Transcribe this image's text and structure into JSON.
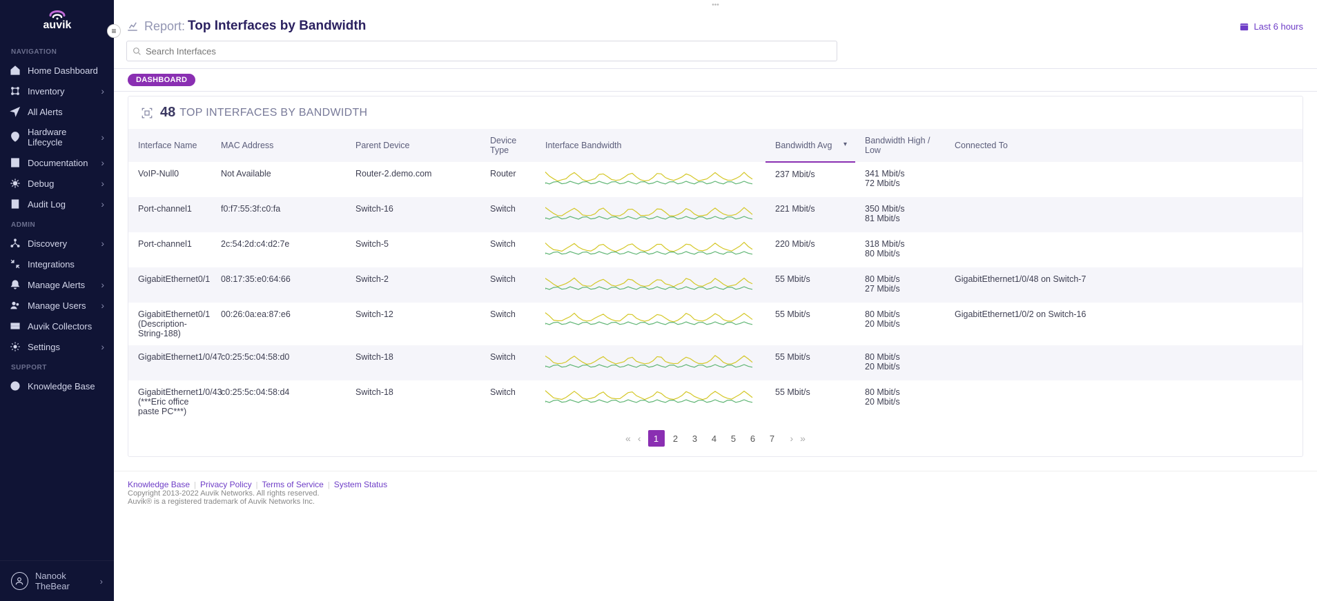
{
  "sidebar": {
    "navLabel": "NAVIGATION",
    "adminLabel": "ADMIN",
    "supportLabel": "SUPPORT",
    "items": [
      {
        "label": "Home Dashboard",
        "expandable": false
      },
      {
        "label": "Inventory",
        "expandable": true
      },
      {
        "label": "All Alerts",
        "expandable": false
      },
      {
        "label": "Hardware Lifecycle",
        "expandable": true
      },
      {
        "label": "Documentation",
        "expandable": true
      },
      {
        "label": "Debug",
        "expandable": true
      },
      {
        "label": "Audit Log",
        "expandable": true
      }
    ],
    "adminItems": [
      {
        "label": "Discovery",
        "expandable": true
      },
      {
        "label": "Integrations",
        "expandable": false
      },
      {
        "label": "Manage Alerts",
        "expandable": true
      },
      {
        "label": "Manage Users",
        "expandable": true
      },
      {
        "label": "Auvik Collectors",
        "expandable": false
      },
      {
        "label": "Settings",
        "expandable": true
      }
    ],
    "supportItems": [
      {
        "label": "Knowledge Base",
        "expandable": false
      }
    ],
    "user": "Nanook TheBear"
  },
  "header": {
    "reportLabel": "Report:",
    "title": "Top Interfaces by Bandwidth",
    "timeRange": "Last 6 hours"
  },
  "search": {
    "placeholder": "Search Interfaces"
  },
  "chip": "DASHBOARD",
  "panel": {
    "count": "48",
    "title": "TOP INTERFACES BY BANDWIDTH"
  },
  "columns": [
    "Interface Name",
    "MAC Address",
    "Parent Device",
    "Device Type",
    "Interface Bandwidth",
    "Bandwidth Avg",
    "Bandwidth High / Low",
    "Connected To"
  ],
  "sortColumnIndex": 5,
  "rows": [
    {
      "name": "VoIP-Null0",
      "mac": "Not Available",
      "parent": "Router-2.demo.com",
      "type": "Router",
      "avg": "237 Mbit/s",
      "high": "341 Mbit/s",
      "low": "72 Mbit/s",
      "connected": ""
    },
    {
      "name": "Port-channel1",
      "mac": "f0:f7:55:3f:c0:fa",
      "parent": "Switch-16",
      "type": "Switch",
      "avg": "221 Mbit/s",
      "high": "350 Mbit/s",
      "low": "81 Mbit/s",
      "connected": ""
    },
    {
      "name": "Port-channel1",
      "mac": "2c:54:2d:c4:d2:7e",
      "parent": "Switch-5",
      "type": "Switch",
      "avg": "220 Mbit/s",
      "high": "318 Mbit/s",
      "low": "80 Mbit/s",
      "connected": ""
    },
    {
      "name": "GigabitEthernet0/1",
      "mac": "08:17:35:e0:64:66",
      "parent": "Switch-2",
      "type": "Switch",
      "avg": "55 Mbit/s",
      "high": "80 Mbit/s",
      "low": "27 Mbit/s",
      "connected": "GigabitEthernet1/0/48 on Switch-7"
    },
    {
      "name": "GigabitEthernet0/1 (Description-String-188)",
      "mac": "00:26:0a:ea:87:e6",
      "parent": "Switch-12",
      "type": "Switch",
      "avg": "55 Mbit/s",
      "high": "80 Mbit/s",
      "low": "20 Mbit/s",
      "connected": "GigabitEthernet1/0/2 on Switch-16"
    },
    {
      "name": "GigabitEthernet1/0/47",
      "mac": "c0:25:5c:04:58:d0",
      "parent": "Switch-18",
      "type": "Switch",
      "avg": "55 Mbit/s",
      "high": "80 Mbit/s",
      "low": "20 Mbit/s",
      "connected": ""
    },
    {
      "name": "GigabitEthernet1/0/43 (***Eric office paste PC***)",
      "mac": "c0:25:5c:04:58:d4",
      "parent": "Switch-18",
      "type": "Switch",
      "avg": "55 Mbit/s",
      "high": "80 Mbit/s",
      "low": "20 Mbit/s",
      "connected": ""
    }
  ],
  "pagination": {
    "pages": [
      "1",
      "2",
      "3",
      "4",
      "5",
      "6",
      "7"
    ],
    "active": 1
  },
  "footer": {
    "links": [
      "Knowledge Base",
      "Privacy Policy",
      "Terms of Service",
      "System Status"
    ],
    "copyright": "Copyright 2013-2022 Auvik Networks. All rights reserved.",
    "trademark": "Auvik® is a registered trademark of Auvik Networks Inc."
  }
}
